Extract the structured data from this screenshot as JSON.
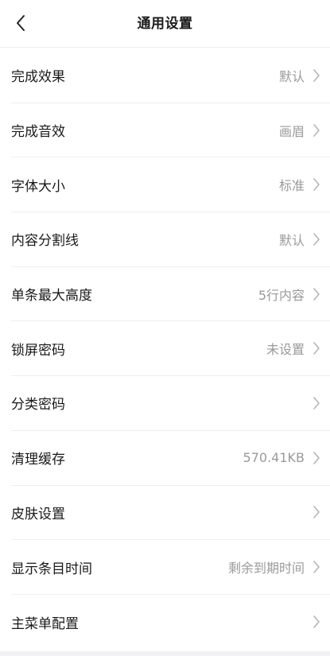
{
  "header": {
    "title": "通用设置",
    "back_icon": "chevron-left-icon"
  },
  "settings": [
    {
      "key": "completion-effect",
      "label": "完成效果",
      "value": "默认"
    },
    {
      "key": "completion-sound",
      "label": "完成音效",
      "value": "画眉"
    },
    {
      "key": "font-size",
      "label": "字体大小",
      "value": "标准"
    },
    {
      "key": "content-divider",
      "label": "内容分割线",
      "value": "默认"
    },
    {
      "key": "max-item-height",
      "label": "单条最大高度",
      "value": "5行内容"
    },
    {
      "key": "lock-screen-password",
      "label": "锁屏密码",
      "value": "未设置"
    },
    {
      "key": "category-password",
      "label": "分类密码",
      "value": ""
    },
    {
      "key": "clear-cache",
      "label": "清理缓存",
      "value": "570.41KB"
    },
    {
      "key": "skin-settings",
      "label": "皮肤设置",
      "value": ""
    },
    {
      "key": "show-item-time",
      "label": "显示条目时间",
      "value": "剩余到期时间"
    },
    {
      "key": "main-menu-config",
      "label": "主菜单配置",
      "value": ""
    }
  ],
  "row_icon": "chevron-right-icon",
  "colors": {
    "text_primary": "#1a1a1a",
    "text_secondary": "#9a9a9a",
    "divider": "#efefef",
    "chevron": "#b5b5b5"
  }
}
